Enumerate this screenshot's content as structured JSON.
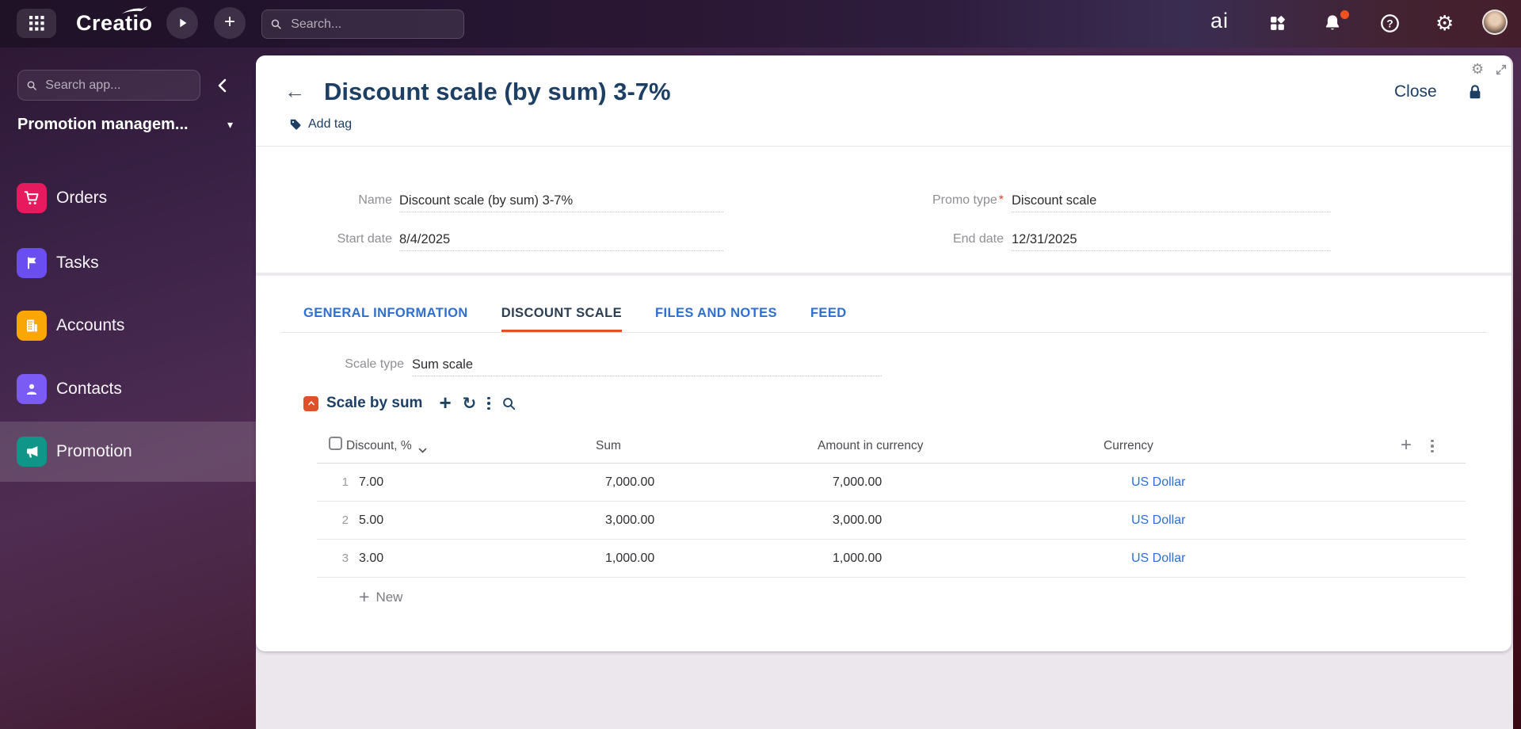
{
  "topbar": {
    "logo": "Creatio",
    "search_placeholder": "Search...",
    "copilot_label": "ai",
    "icons": [
      "app-launcher-grid",
      "play",
      "add",
      "search",
      "copilot-ai",
      "workspaces",
      "notifications-bell",
      "help",
      "settings-gear",
      "user-avatar"
    ]
  },
  "sidebar": {
    "search_placeholder": "Search app...",
    "workspace": "Promotion managem...",
    "items": [
      {
        "label": "Orders",
        "color": "#E7195F",
        "icon": "cart",
        "active": false
      },
      {
        "label": "Tasks",
        "color": "#6B4EEF",
        "icon": "flag",
        "active": false
      },
      {
        "label": "Accounts",
        "color": "#F9A606",
        "icon": "building",
        "active": false
      },
      {
        "label": "Contacts",
        "color": "#7A5CF5",
        "icon": "person",
        "active": false
      },
      {
        "label": "Promotion",
        "color": "#0F9688",
        "icon": "megaphone",
        "active": true
      }
    ]
  },
  "header": {
    "title": "Discount scale (by sum) 3-7%",
    "add_tag": "Add tag",
    "close": "Close"
  },
  "fields": {
    "name": {
      "label": "Name",
      "value": "Discount scale (by sum) 3-7%"
    },
    "promo_type": {
      "label": "Promo type",
      "required": "*",
      "value": "Discount scale"
    },
    "start_date": {
      "label": "Start date",
      "value": "8/4/2025"
    },
    "end_date": {
      "label": "End date",
      "value": "12/31/2025"
    }
  },
  "tabs": [
    {
      "label": "GENERAL INFORMATION",
      "active": false
    },
    {
      "label": "DISCOUNT SCALE",
      "active": true
    },
    {
      "label": "FILES AND NOTES",
      "active": false
    },
    {
      "label": "FEED",
      "active": false
    }
  ],
  "scale": {
    "type_label": "Scale type",
    "type_value": "Sum scale",
    "detail_title": "Scale by sum"
  },
  "table": {
    "headers": {
      "discount": "Discount, %",
      "sum": "Sum",
      "amount": "Amount in currency",
      "currency": "Currency"
    },
    "rows": [
      {
        "n": "1",
        "discount": "7.00",
        "sum": "7,000.00",
        "amount": "7,000.00",
        "currency": "US Dollar"
      },
      {
        "n": "2",
        "discount": "5.00",
        "sum": "3,000.00",
        "amount": "3,000.00",
        "currency": "US Dollar"
      },
      {
        "n": "3",
        "discount": "3.00",
        "sum": "1,000.00",
        "amount": "1,000.00",
        "currency": "US Dollar"
      }
    ],
    "new_label": "New"
  },
  "colors": {
    "accent_orange": "#E0512A",
    "link_blue": "#2E6FD0",
    "title_navy": "#1D3F63",
    "notification_dot": "#F4511E",
    "content_bg": "#EBE7EC"
  }
}
